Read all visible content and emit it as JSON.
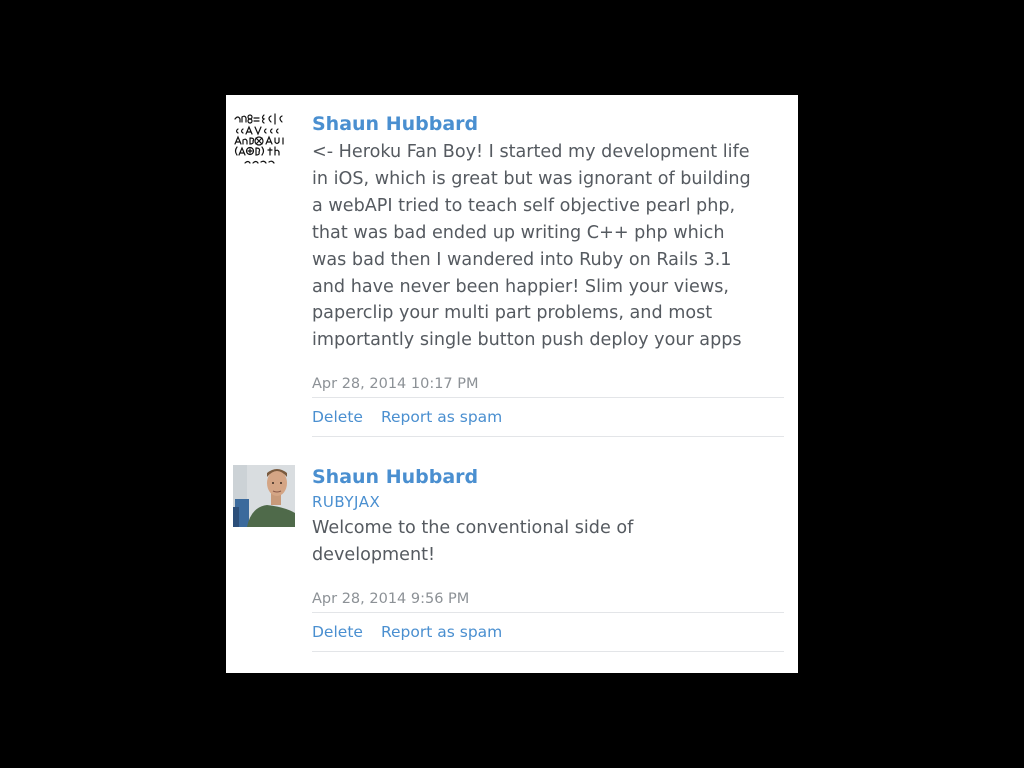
{
  "comments": [
    {
      "author": "Shaun Hubbard",
      "tagline": "",
      "avatar": "handwritten-math-avatar",
      "text": "<- Heroku Fan Boy! I started my development life\nin iOS, which is great but was ignorant of building\na webAPI tried to teach self objective pearl php,\nthat was bad ended up writing C++ php which\nwas bad then I wandered into Ruby on Rails 3.1\nand have never been happier! Slim your views,\npaperclip your multi part problems, and most\nimportantly single button push deploy your apps",
      "timestamp": "Apr 28, 2014 10:17 PM",
      "delete_label": "Delete",
      "spam_label": "Report as spam"
    },
    {
      "author": "Shaun Hubbard",
      "tagline": "RUBYJAX",
      "avatar": "photo-avatar",
      "text": "Welcome to the conventional side of\ndevelopment!",
      "timestamp": "Apr 28, 2014 9:56 PM",
      "delete_label": "Delete",
      "spam_label": "Report as spam"
    }
  ],
  "colors": {
    "link": "#4a8fd0",
    "text": "#555a60",
    "muted": "#8c9196",
    "background": "#000000",
    "panel": "#ffffff"
  }
}
